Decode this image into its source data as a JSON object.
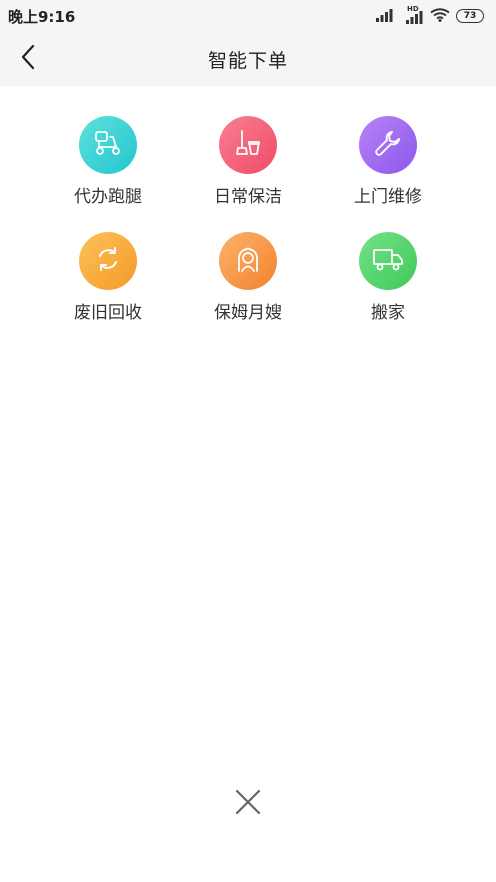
{
  "status_bar": {
    "time": "晚上9:16",
    "network_label": "HD",
    "battery": "73"
  },
  "nav": {
    "title": "智能下单",
    "back_icon": "chevron-left-icon"
  },
  "services": [
    {
      "label": "代办跑腿",
      "icon": "scooter-icon",
      "color_from": "#5ee0dd",
      "color_to": "#22c6cf"
    },
    {
      "label": "日常保洁",
      "icon": "mop-bucket-icon",
      "color_from": "#fa7f92",
      "color_to": "#ef4b66"
    },
    {
      "label": "上门维修",
      "icon": "wrench-icon",
      "color_from": "#b983f5",
      "color_to": "#8b57ec"
    },
    {
      "label": "废旧回收",
      "icon": "recycle-icon",
      "color_from": "#fcc25b",
      "color_to": "#f59a26"
    },
    {
      "label": "保姆月嫂",
      "icon": "nanny-icon",
      "color_from": "#fcb26a",
      "color_to": "#f3832e"
    },
    {
      "label": "搬家",
      "icon": "truck-icon",
      "color_from": "#74e287",
      "color_to": "#3fc95a"
    }
  ],
  "close_icon": "close-icon"
}
